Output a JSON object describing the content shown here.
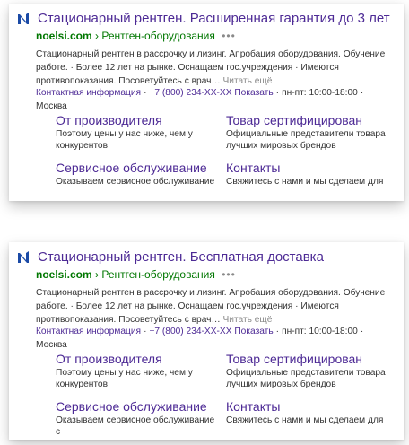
{
  "ads": [
    {
      "title": "Стационарный рентген. Расширенная гарантия до 3 лет",
      "domain": "noelsi.com",
      "separator": "›",
      "path": "Рентген-оборудования",
      "menu_dots": "•••",
      "description": "Стационарный рентген в рассрочку и лизинг. Апробация оборудования. Обучение работе. · Более 12 лет на рынке. Оснащаем гос.учреждения · Имеются противопоказания. Посоветуйтесь с врач…",
      "read_more": "Читать ещё",
      "contact_info": "Контактная информация",
      "phone": "+7 (800) 234-XX-XX",
      "show_phone": "Показать",
      "hours": "пн-пт: 10:00-18:00",
      "city": "Москва",
      "sitelinks": [
        {
          "title": "От производителя",
          "desc": "Поэтому цены у нас ниже, чем у конкурентов"
        },
        {
          "title": "Товар сертифицирован",
          "desc": "Официальные представители товара лучших мировых брендов"
        },
        {
          "title": "Сервисное обслуживание",
          "desc": "Оказываем сервисное обслуживание"
        },
        {
          "title": "Контакты",
          "desc": "Свяжитесь с нами и мы сделаем для"
        }
      ]
    },
    {
      "title": "Стационарный рентген. Бесплатная доставка",
      "domain": "noelsi.com",
      "separator": "›",
      "path": "Рентген-оборудования",
      "menu_dots": "•••",
      "description": "Стационарный рентген в рассрочку и лизинг. Апробация оборудования. Обучение работе. · Более 12 лет на рынке. Оснащаем гос.учреждения · Имеются противопоказания. Посоветуйтесь с врач…",
      "read_more": "Читать ещё",
      "contact_info": "Контактная информация",
      "phone": "+7 (800) 234-XX-XX",
      "show_phone": "Показать",
      "hours": "пн-пт: 10:00-18:00",
      "city": "Москва",
      "sitelinks": [
        {
          "title": "От производителя",
          "desc": "Поэтому цены у нас ниже, чем у конкурентов"
        },
        {
          "title": "Товар сертифицирован",
          "desc": "Официальные представители товара лучших мировых брендов"
        },
        {
          "title": "Сервисное обслуживание",
          "desc": "Оказываем сервисное обслуживание с"
        },
        {
          "title": "Контакты",
          "desc": "Свяжитесь с нами и мы сделаем для"
        }
      ]
    }
  ],
  "colors": {
    "title": "#4d2a95",
    "url": "#007700",
    "text": "#333333",
    "muted": "#8a8a8a",
    "favicon": "#1b4aa6"
  },
  "icons": {
    "favicon": "noelsi-n-favicon-icon"
  }
}
